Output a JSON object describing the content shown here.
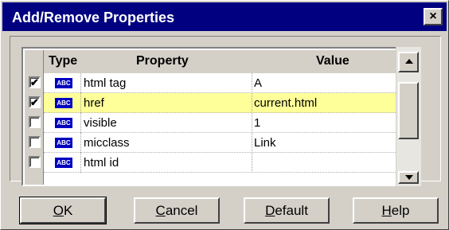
{
  "dialog": {
    "title": "Add/Remove Properties",
    "close_glyph": "×"
  },
  "grid": {
    "headers": {
      "type": "Type",
      "property": "Property",
      "value": "Value"
    },
    "type_badge": "ABC",
    "rows": [
      {
        "checked": true,
        "check_glyph": "✔",
        "property": "html tag",
        "value": "A",
        "selected": false
      },
      {
        "checked": true,
        "check_glyph": "✔",
        "property": "href",
        "value": "current.html",
        "selected": true
      },
      {
        "checked": false,
        "check_glyph": "",
        "property": "visible",
        "value": "1",
        "selected": false
      },
      {
        "checked": false,
        "check_glyph": "",
        "property": "micclass",
        "value": "Link",
        "selected": false
      },
      {
        "checked": false,
        "check_glyph": "",
        "property": "html id",
        "value": "",
        "selected": false
      }
    ],
    "selected_row_color": "#ffff99"
  },
  "buttons": {
    "ok": {
      "mnemonic": "O",
      "rest": "K"
    },
    "cancel": {
      "mnemonic": "C",
      "rest": "ancel"
    },
    "default": {
      "mnemonic": "D",
      "rest": "efault"
    },
    "help": {
      "mnemonic": "H",
      "rest": "elp"
    }
  },
  "colors": {
    "titlebar": "#000080",
    "face": "#d4d0c8",
    "badge": "#0000c0"
  }
}
